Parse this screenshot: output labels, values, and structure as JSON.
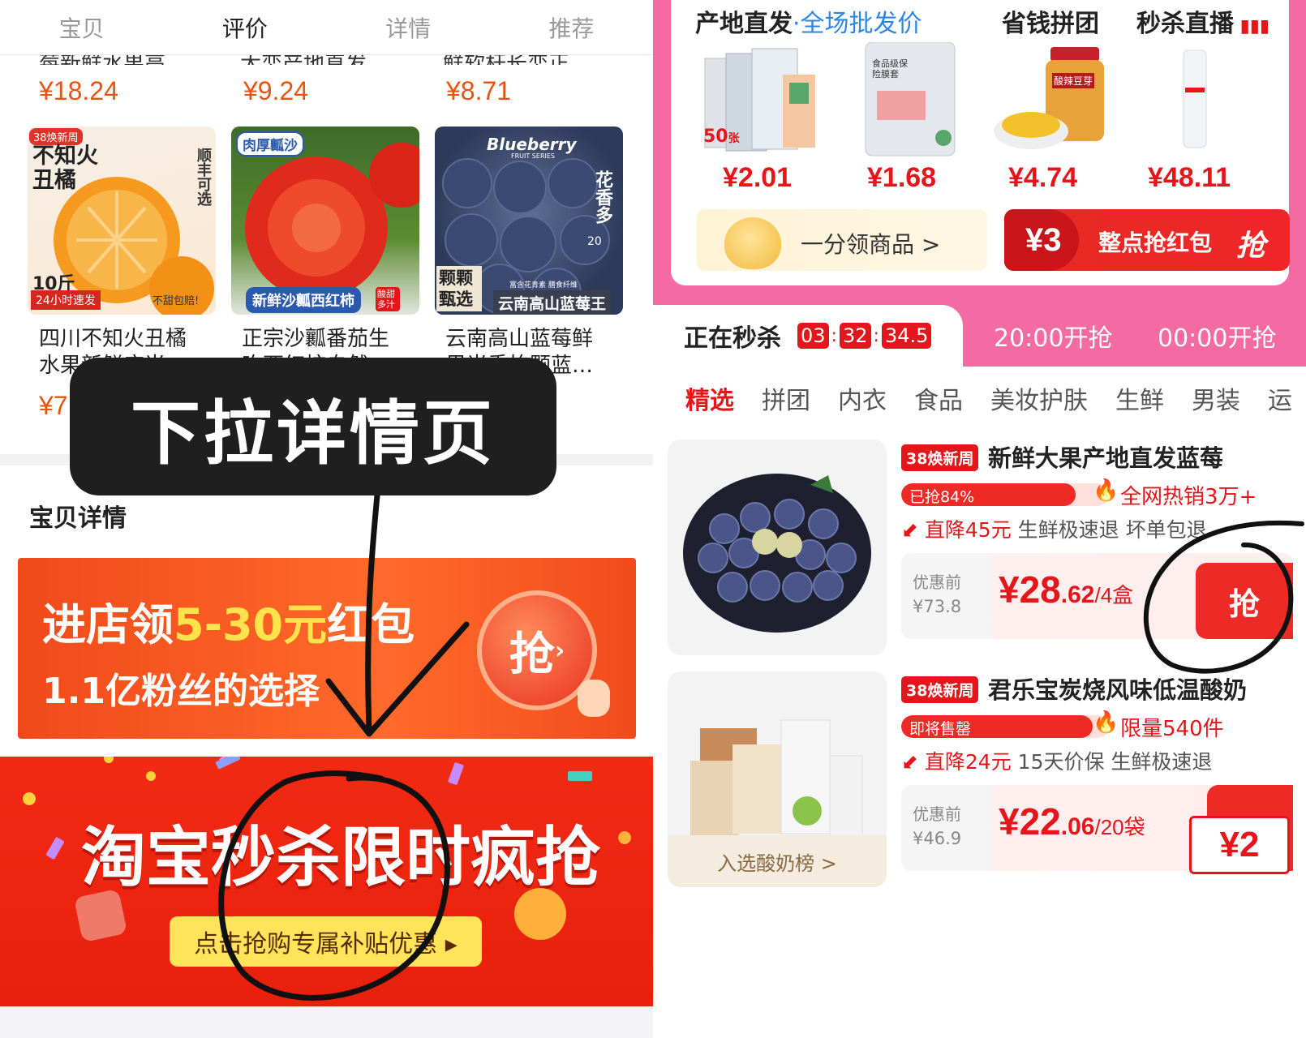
{
  "left": {
    "tabs": [
      "宝贝",
      "评价",
      "详情",
      "推荐"
    ],
    "top_row": {
      "titles": [
        "莓新鲜水果高…",
        "大恋产地直发…",
        "鲜软杆长恋正…"
      ],
      "prices": [
        "¥18.24",
        "¥9.24",
        "¥8.71"
      ]
    },
    "products": [
      {
        "title1": "四川不知火丑橘",
        "title2": "水果新鲜应当…",
        "price": "¥7.79",
        "img_tag": "38焕新周",
        "img_title": "不知火丑橘",
        "img_side": "顺丰可选",
        "img_weight": "10斤",
        "img_ship": "24小时速发",
        "img_guarantee": "不甜包赔!"
      },
      {
        "title1": "正宗沙瓤番茄生",
        "title2": "吃西红柿自然…",
        "price": "¥",
        "img_tag": "肉厚瓤沙",
        "img_bottom": "新鲜沙瓤西红柿",
        "img_badge": "酸甜多汁"
      },
      {
        "title1": "云南高山蓝莓鲜",
        "title2": "果当季怡颗蓝…",
        "price": "¥",
        "img_brand": "Blueberry",
        "img_brand_sub": "FRUIT SERIES",
        "img_side": "花香多",
        "img_side_num": "20",
        "img_left": "颗颗甄选",
        "img_bottom_small": "富含花青素 膳食纤维",
        "img_bottom": "云南高山蓝莓王"
      }
    ],
    "overlay_text": "下拉详情页",
    "section_title": "宝贝详情",
    "promo1": {
      "line1a": "进店领",
      "line1b": "5-30元",
      "line1c": "红包",
      "line2": "1.1亿粉丝的选择",
      "btn": "抢"
    },
    "promo2": {
      "title": "淘宝秒杀限时疯抢",
      "btn": "点击抢购专属补贴优惠 ▸"
    }
  },
  "right": {
    "channels": [
      {
        "name": "产地直发",
        "sub": "·全场批发价"
      },
      {
        "name": "省钱拼团"
      },
      {
        "name": "秒杀直播"
      }
    ],
    "prices": [
      "¥2.01",
      "¥1.68",
      "¥4.74",
      "¥48.11"
    ],
    "thumb_labels": {
      "a_count": "50",
      "a_unit": "张",
      "b_label": "食品级保险膜套",
      "c_label": "酸辣豆芽"
    },
    "mini_left": "一分领商品 >",
    "mini_right": {
      "amount": "¥3",
      "label": "整点抢红包",
      "btn": "抢"
    },
    "flash": {
      "label": "正在秒杀",
      "h": "03",
      "m": "32",
      "s": "34.5",
      "next1": "20:00开抢",
      "next2": "00:00开抢"
    },
    "categories": [
      "精选",
      "拼团",
      "内衣",
      "食品",
      "美妆护肤",
      "生鲜",
      "男装",
      "运"
    ],
    "items": [
      {
        "badge": "38焕新周",
        "title": "新鲜大果产地直发蓝莓",
        "progress_label": "已抢84%",
        "progress": 0.84,
        "hot": "全网热销3万+",
        "tag1": "直降45元",
        "tags": "生鲜极速退  坏单包退",
        "orig_label": "优惠前",
        "orig": "¥73.8",
        "price_main": "¥28",
        "price_dec": ".62",
        "unit": "/4盒",
        "btn": "抢"
      },
      {
        "badge": "38焕新周",
        "title": "君乐宝炭烧风味低温酸奶",
        "progress_label": "即将售罄",
        "progress": 0.92,
        "hot": "限量540件",
        "tag1": "直降24元",
        "tags": "15天价保  生鲜极速退",
        "orig_label": "优惠前",
        "orig": "¥46.9",
        "price_main": "¥22",
        "price_dec": ".06",
        "unit": "/20袋",
        "btn": "¥2",
        "img_caption": "入选酸奶榜 >"
      }
    ]
  }
}
